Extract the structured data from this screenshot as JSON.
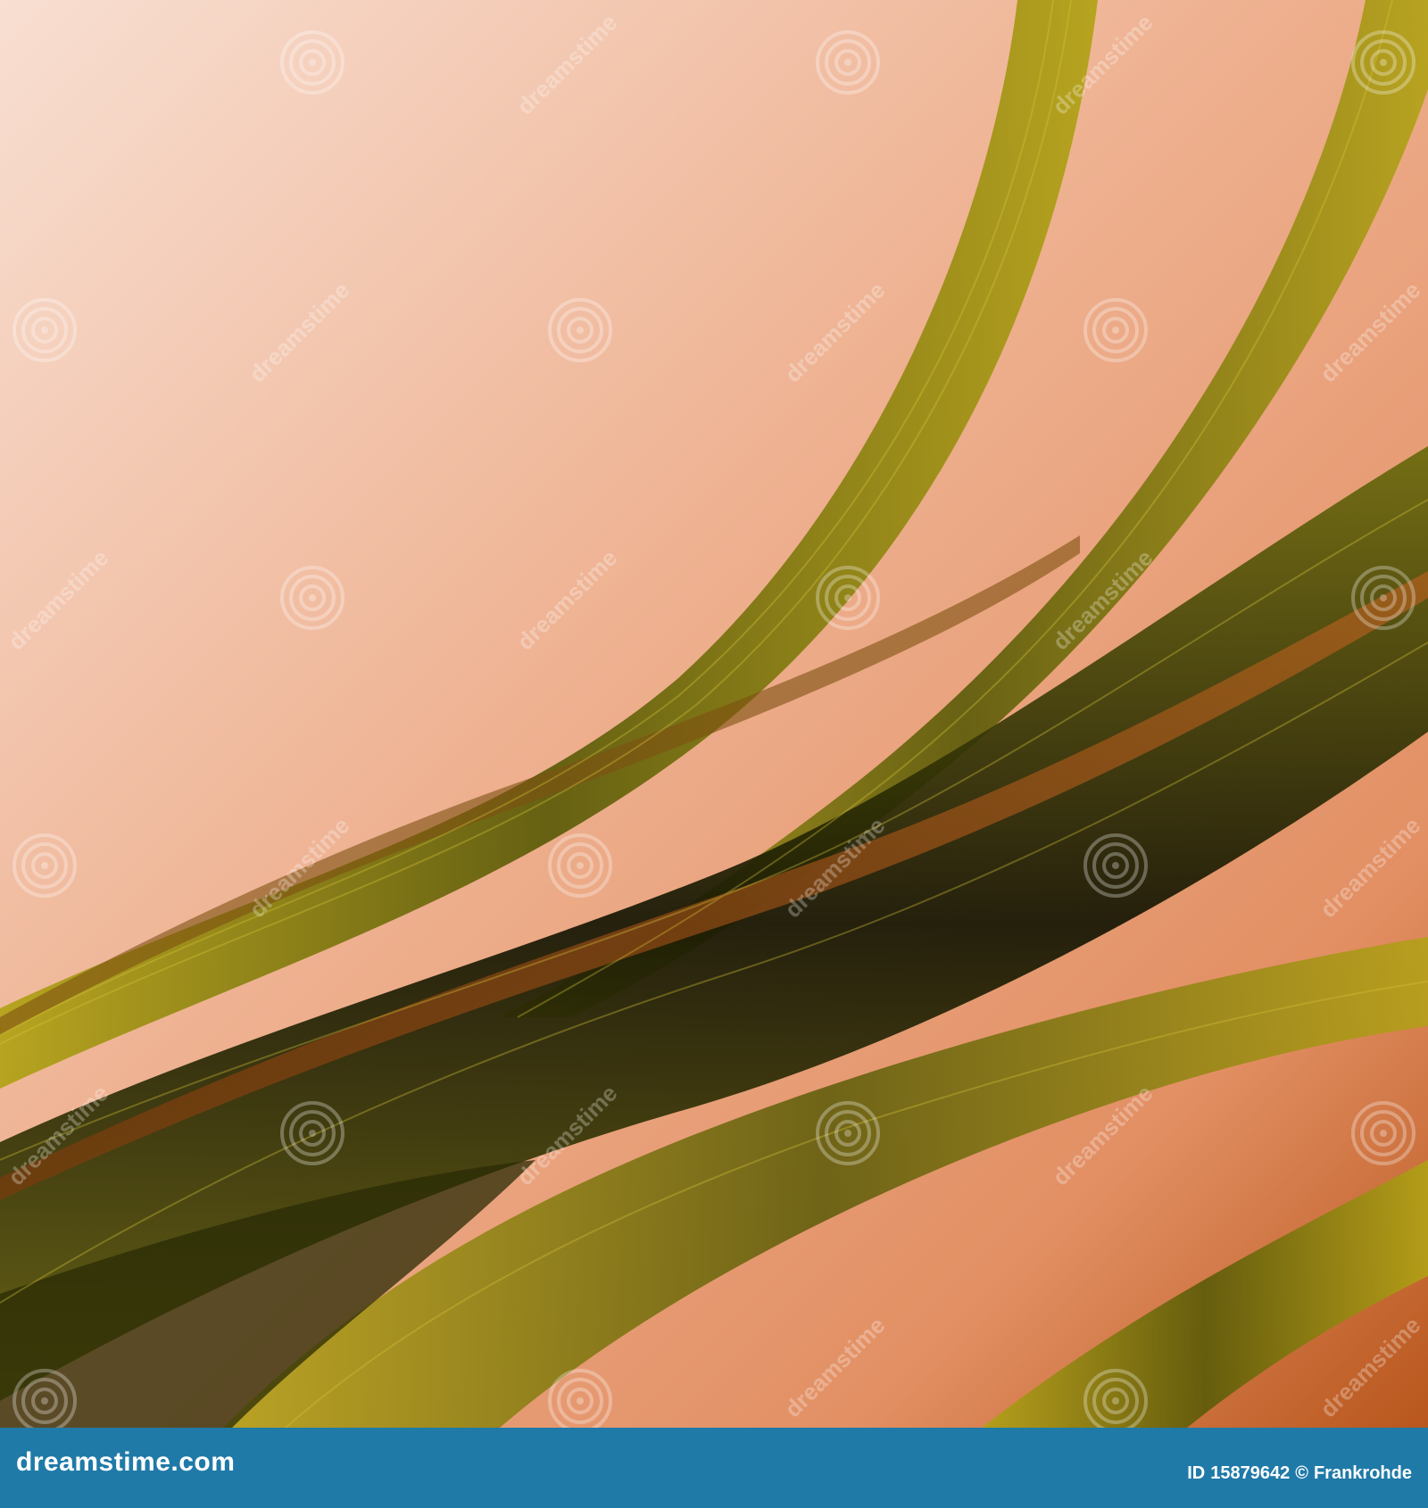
{
  "image": {
    "description": "Abstract background with flowing olive-green and black wave bands over a peach-to-orange gradient",
    "colors": {
      "background_light": "#f6d6c6",
      "background_mid": "#e9a27d",
      "background_dark": "#c05a1e",
      "wave_olive": "#8a8a10",
      "wave_dark": "#1e1f05",
      "wave_orange": "#a24e18",
      "footer_bar": "#1f7aa8"
    }
  },
  "watermark": {
    "text": "dreamstime",
    "icon": "spiral-icon"
  },
  "footer": {
    "site": "dreamstime.com",
    "id_label": "ID",
    "id_value": "15879642",
    "copyright_symbol": "©",
    "author": "Frankrohde"
  }
}
